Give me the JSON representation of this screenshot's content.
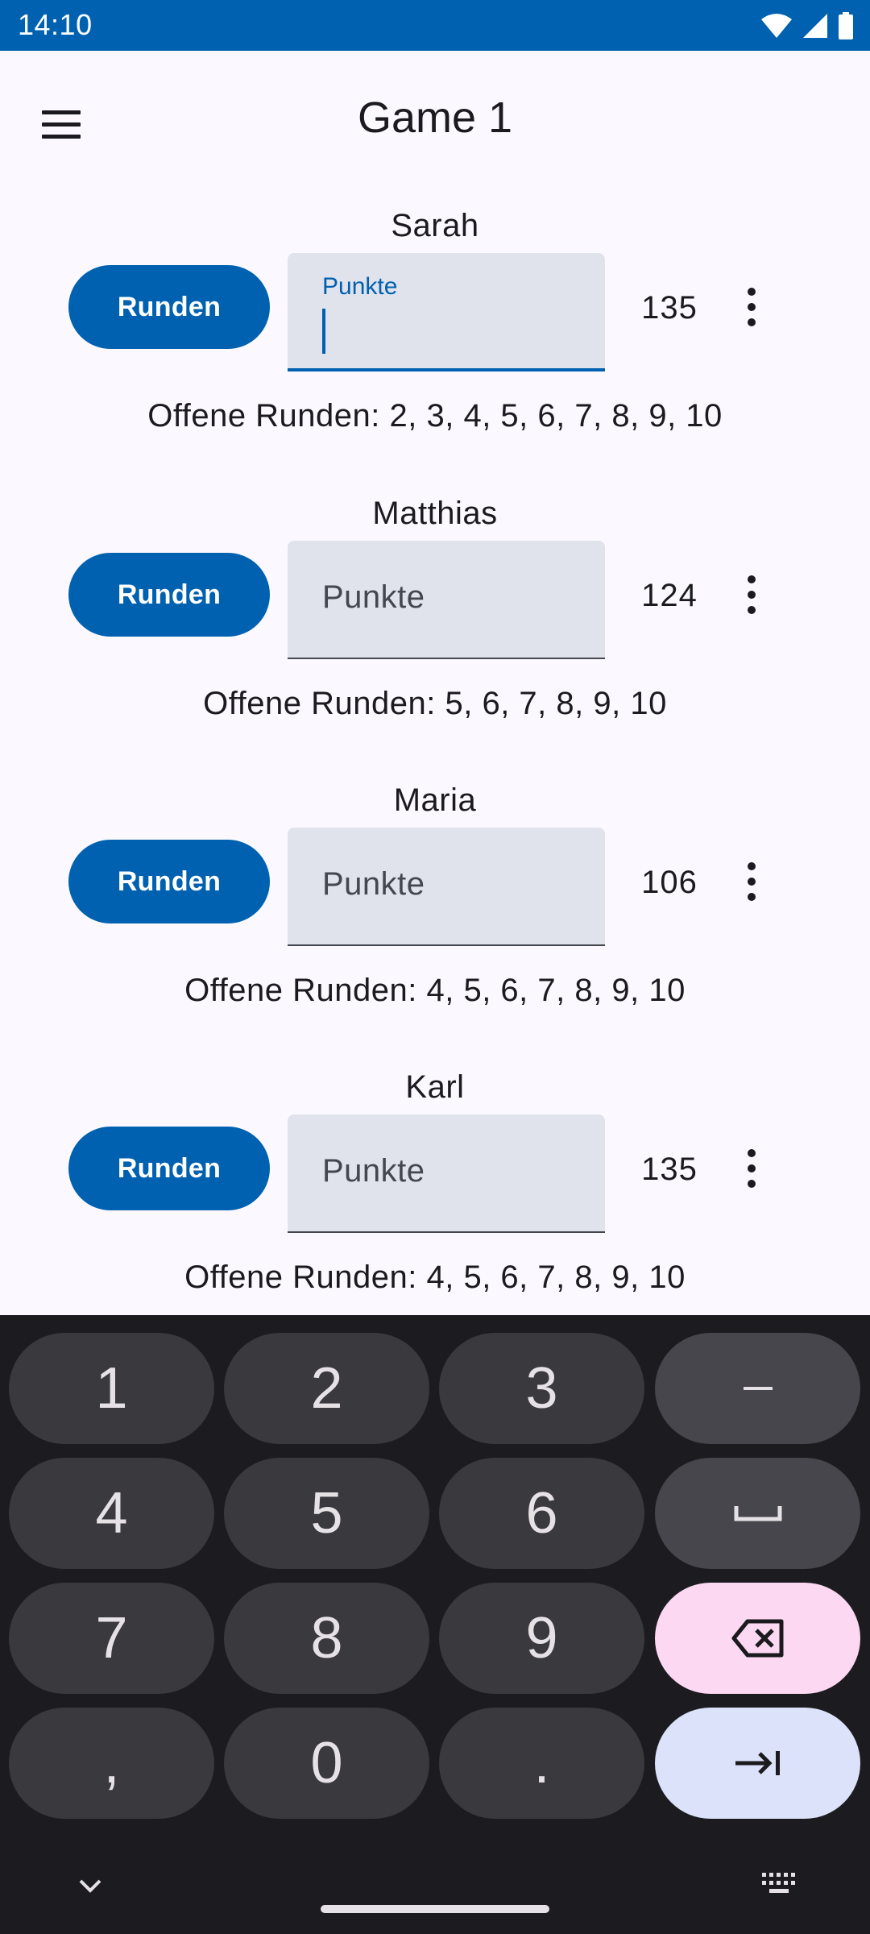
{
  "status_bar": {
    "time": "14:10",
    "icons": [
      "wifi-icon",
      "cell-signal-icon",
      "battery-icon"
    ]
  },
  "app_bar": {
    "title": "Game 1",
    "menu_icon": "hamburger-menu-icon"
  },
  "players": [
    {
      "name": "Sarah",
      "rounds_label": "Runden",
      "points_label": "Punkte",
      "points_value": "",
      "focused": true,
      "score": "135",
      "open_rounds": "Offene Runden: 2, 3, 4, 5, 6, 7, 8, 9, 10"
    },
    {
      "name": "Matthias",
      "rounds_label": "Runden",
      "points_label": "Punkte",
      "points_value": "",
      "focused": false,
      "score": "124",
      "open_rounds": "Offene Runden: 5, 6, 7, 8, 9, 10"
    },
    {
      "name": "Maria",
      "rounds_label": "Runden",
      "points_label": "Punkte",
      "points_value": "",
      "focused": false,
      "score": "106",
      "open_rounds": "Offene Runden: 4, 5, 6, 7, 8, 9, 10"
    },
    {
      "name": "Karl",
      "rounds_label": "Runden",
      "points_label": "Punkte",
      "points_value": "",
      "focused": false,
      "score": "135",
      "open_rounds": "Offene Runden: 4, 5, 6, 7, 8, 9, 10"
    }
  ],
  "keyboard": {
    "rows": [
      [
        "1",
        "2",
        "3",
        "−"
      ],
      [
        "4",
        "5",
        "6",
        "␣"
      ],
      [
        "7",
        "8",
        "9",
        "⌫"
      ],
      [
        ",",
        "0",
        ".",
        "⇥"
      ]
    ],
    "special_icons": {
      "space": "space-bar-icon",
      "backspace": "backspace-icon",
      "next": "tab-next-icon",
      "hide": "chevron-down-icon",
      "switch": "keyboard-icon"
    },
    "colors": {
      "background": "#1c1b1f",
      "key": "#3a393e",
      "backspace": "#fcd8f3",
      "next": "#dce2f9"
    }
  },
  "colors": {
    "primary": "#0061b0",
    "field_bg": "#e0e2ec",
    "surface": "#fbf9ff"
  }
}
